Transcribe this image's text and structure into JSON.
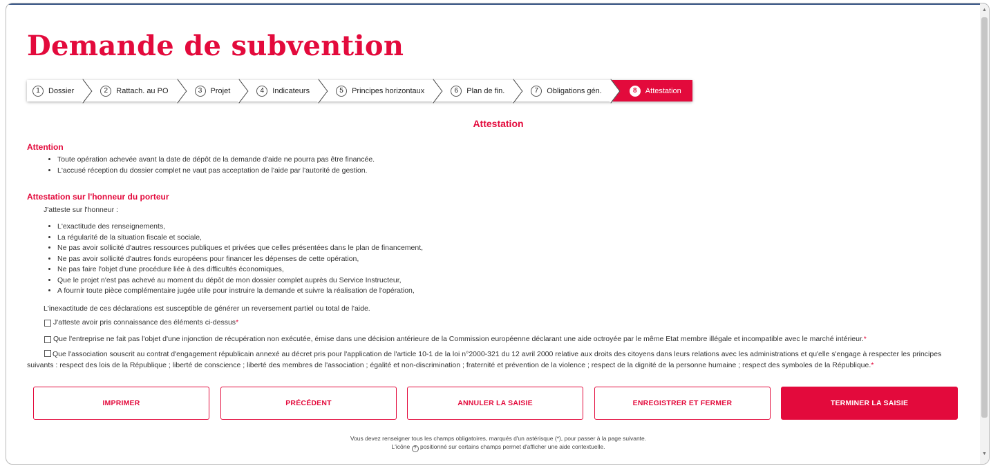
{
  "title": "Demande de subvention",
  "steps": [
    {
      "num": "1",
      "label": "Dossier"
    },
    {
      "num": "2",
      "label": "Rattach. au PO"
    },
    {
      "num": "3",
      "label": "Projet"
    },
    {
      "num": "4",
      "label": "Indicateurs"
    },
    {
      "num": "5",
      "label": "Principes horizontaux"
    },
    {
      "num": "6",
      "label": "Plan de fin."
    },
    {
      "num": "7",
      "label": "Obligations gén."
    },
    {
      "num": "8",
      "label": "Attestation",
      "active": true
    }
  ],
  "section_title": "Attestation",
  "attention": {
    "heading": "Attention",
    "items": [
      "Toute opération achevée avant la date de dépôt de la demande d'aide ne pourra pas être financée.",
      "L'accusé réception du dossier complet ne vaut pas acceptation de l'aide par l'autorité de gestion."
    ]
  },
  "honneur": {
    "heading": "Attestation sur l'honneur du porteur",
    "intro": "J'atteste sur l'honneur :",
    "items": [
      "L'exactitude des renseignements,",
      "La régularité de la situation fiscale et sociale,",
      "Ne pas avoir sollicité d'autres ressources publiques et privées que celles présentées dans le plan de financement,",
      "Ne pas avoir sollicité d'autres fonds européens pour financer les dépenses de cette opération,",
      "Ne pas faire l'objet d'une procédure liée à des difficultés économiques,",
      "Que le projet n'est pas achevé au moment du dépôt de mon dossier complet auprès du Service Instructeur,",
      "A fournir toute pièce complémentaire jugée utile pour instruire la demande et suivre la réalisation de l'opération,"
    ],
    "warning": "L'inexactitude de ces déclarations est susceptible de générer un reversement partiel ou total de l'aide."
  },
  "checks": {
    "c1": "J'atteste avoir pris connaissance des éléments ci-dessus",
    "c2": "Que l'entreprise ne fait pas l'objet d'une injonction de récupération non exécutée, émise dans une décision antérieure de la Commission européenne déclarant une aide octroyée par le même Etat membre illégale et incompatible avec le marché intérieur.",
    "c3": "Que l'association souscrit au contrat d'engagement républicain annexé au décret pris pour l'application de l'article 10-1 de la loi n°2000-321 du 12 avril 2000 relative aux droits des citoyens dans leurs relations avec les administrations et qu'elle s'engage à respecter les principes suivants : respect des lois de la République ; liberté de conscience ; liberté des membres de l'association ;  égalité et non-discrimination ; fraternité et prévention de la violence ; respect de la dignité de la personne humaine ; respect des symboles de la République.",
    "required_mark": "*"
  },
  "buttons": {
    "print": "IMPRIMER",
    "previous": "PRÉCÉDENT",
    "cancel": "ANNULER LA SAISIE",
    "save_close": "ENREGISTRER ET FERMER",
    "finish": "TERMINER LA SAISIE"
  },
  "footer": {
    "line1": "Vous devez renseigner tous les champs obligatoires, marqués d'un astérisque (*), pour passer à la page suivante.",
    "line2_a": "L'icône",
    "help_glyph": "?",
    "line2_b": "positionné sur certains champs permet d'afficher une aide contextuelle."
  },
  "colors": {
    "accent": "#e30a3c"
  }
}
